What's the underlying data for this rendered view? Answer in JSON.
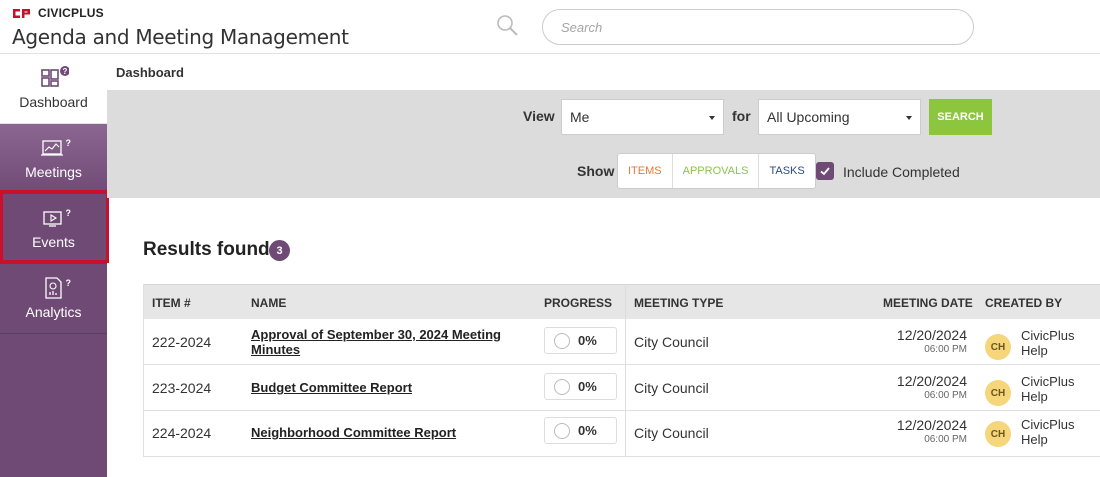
{
  "header": {
    "brand": "CIVICPLUS",
    "app_title": "Agenda and Meeting Management",
    "search_placeholder": "Search"
  },
  "sidebar": {
    "items": [
      {
        "label": "Dashboard",
        "icon": "dashboard-icon",
        "help": "?"
      },
      {
        "label": "Meetings",
        "icon": "meetings-icon",
        "help": "?"
      },
      {
        "label": "Events",
        "icon": "events-icon",
        "help": "?"
      },
      {
        "label": "Analytics",
        "icon": "analytics-icon",
        "help": "?"
      }
    ]
  },
  "breadcrumb": "Dashboard",
  "filters": {
    "view_label": "View",
    "view_value": "Me",
    "for_label": "for",
    "for_value": "All Upcoming",
    "search_button": "SEARCH",
    "show_label": "Show",
    "toggles": [
      {
        "label": "ITEMS",
        "color": "#e07b39"
      },
      {
        "label": "APPROVALS",
        "color": "#8cc63f"
      },
      {
        "label": "TASKS",
        "color": "#2b4a8b"
      }
    ],
    "include_completed_label": "Include Completed",
    "include_completed_checked": true
  },
  "results": {
    "title": "Results found:",
    "count": "3"
  },
  "table": {
    "headers": {
      "item": "ITEM #",
      "name": "NAME",
      "progress": "PROGRESS",
      "meeting_type": "MEETING TYPE",
      "meeting_date": "MEETING DATE",
      "created_by": "CREATED BY"
    },
    "rows": [
      {
        "item": "222-2024",
        "name": "Approval of September 30, 2024 Meeting Minutes",
        "progress": "0%",
        "meeting_type": "City Council",
        "date": "12/20/2024",
        "time": "06:00 PM",
        "initials": "CH",
        "creator": "CivicPlus Help"
      },
      {
        "item": "223-2024",
        "name": "Budget Committee Report",
        "progress": "0%",
        "meeting_type": "City Council",
        "date": "12/20/2024",
        "time": "06:00 PM",
        "initials": "CH",
        "creator": "CivicPlus Help"
      },
      {
        "item": "224-2024",
        "name": "Neighborhood Committee Report",
        "progress": "0%",
        "meeting_type": "City Council",
        "date": "12/20/2024",
        "time": "06:00 PM",
        "initials": "CH",
        "creator": "CivicPlus Help"
      }
    ]
  },
  "colors": {
    "sidebar": "#6e4a74",
    "accent_red": "#c8102e",
    "search_button": "#8cc63f",
    "avatar": "#f6d67a"
  }
}
